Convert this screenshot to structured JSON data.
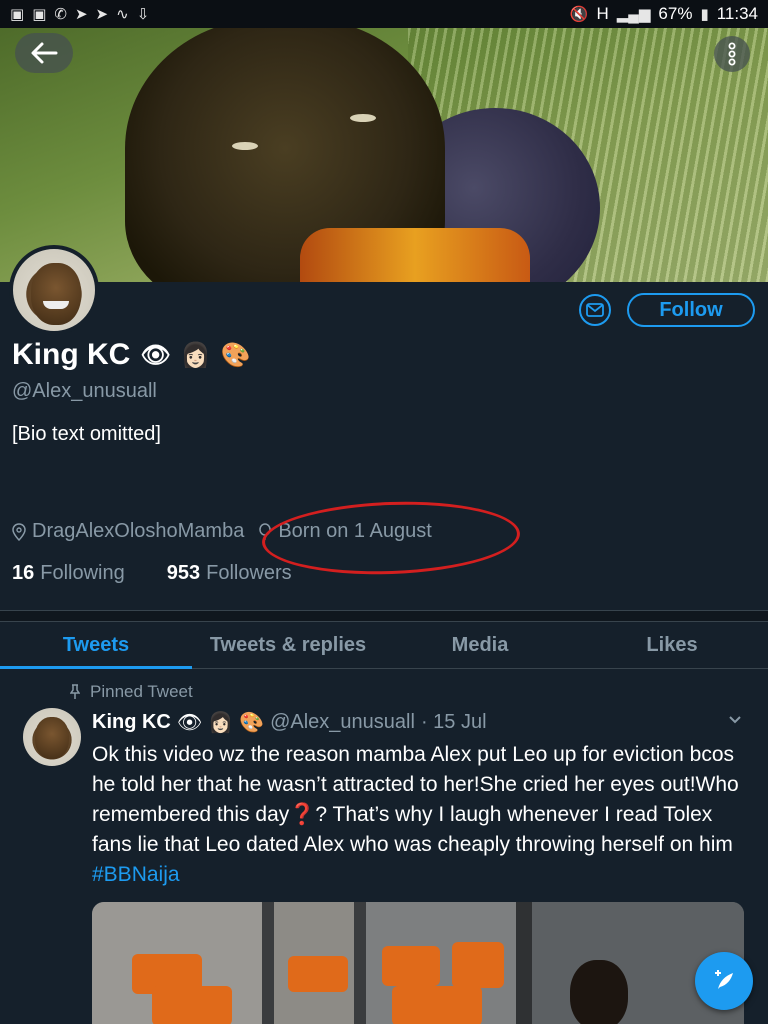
{
  "status_bar": {
    "left_icons": [
      "photo-icon",
      "photo-icon",
      "whatsapp-icon",
      "twitter-icon",
      "twitter-icon",
      "wave-icon",
      "download-icon"
    ],
    "battery": "67%",
    "time": "11:34",
    "network": "H"
  },
  "banner": {
    "back_icon": "arrow-left-icon",
    "more_icon": "vertical-dots-icon"
  },
  "profile": {
    "name": "King KC",
    "name_emoji": [
      "👁",
      "👩🏻",
      "🎨"
    ],
    "handle": "@Alex_unusuall",
    "bio": "[Bio text omitted]",
    "location": "DragAlexOloshoMamba",
    "birthday": "Born on 1 August",
    "following_count": "16",
    "following_label": "Following",
    "followers_count": "953",
    "followers_label": "Followers"
  },
  "actions": {
    "follow_label": "Follow",
    "message_icon": "mail-icon"
  },
  "tabs": [
    {
      "label": "Tweets",
      "active": true
    },
    {
      "label": "Tweets & replies",
      "active": false
    },
    {
      "label": "Media",
      "active": false
    },
    {
      "label": "Likes",
      "active": false
    }
  ],
  "pinned_tweet": {
    "pinned_label": "Pinned Tweet",
    "author_name": "King KC",
    "author_emoji": [
      "👁",
      "👩🏻",
      "🎨"
    ],
    "author_handle": "@Alex_unusuall",
    "date": "· 15 Jul",
    "text": "Ok this video wz the reason mamba Alex put Leo up for eviction bcos he told her that he wasn’t attracted to her!She cried her eyes out!Who remembered this day❓? That’s why I laugh whenever I read Tolex fans lie that Leo dated Alex who was cheaply throwing herself on him",
    "hashtag": "#BBNaija"
  },
  "colors": {
    "background": "#15202b",
    "accent": "#1d9bf0",
    "muted": "#8899a6",
    "annotation": "#d31f1f"
  }
}
